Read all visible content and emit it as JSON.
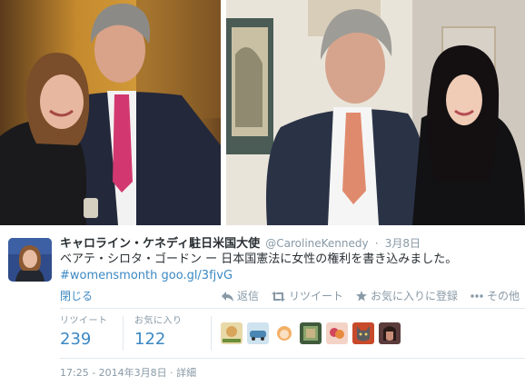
{
  "tweet": {
    "fullname": "キャロライン・ケネディ駐日米国大使",
    "username": "@CarolineKennedy",
    "separator": "·",
    "timestamp": "3月8日",
    "text_line1": "ベアテ・シロタ・ゴードン ー 日本国憲法に女性の権利を書き込みました。",
    "hashtag": "#womensmonth",
    "link": "goo.gl/3fjvG",
    "collapse_label": "閉じる"
  },
  "actions": {
    "reply_label": "返信",
    "retweet_label": "リツイート",
    "favorite_label": "お気に入りに登録",
    "more_label": "その他"
  },
  "stats": {
    "retweets_label": "リツイート",
    "retweets_value": "239",
    "favorites_label": "お気に入り",
    "favorites_value": "122"
  },
  "meta": {
    "datetime": "17:25 - 2014年3月8日",
    "separator": "·",
    "detail_label": "詳細"
  },
  "icons": {
    "reply": "reply-arrow-icon",
    "retweet": "retweet-icon",
    "favorite": "star-icon",
    "more": "more-dots-icon"
  },
  "colors": {
    "link": "#3b88c3",
    "muted": "#8899a6",
    "text": "#292f33",
    "divider": "#e1e8ed"
  }
}
